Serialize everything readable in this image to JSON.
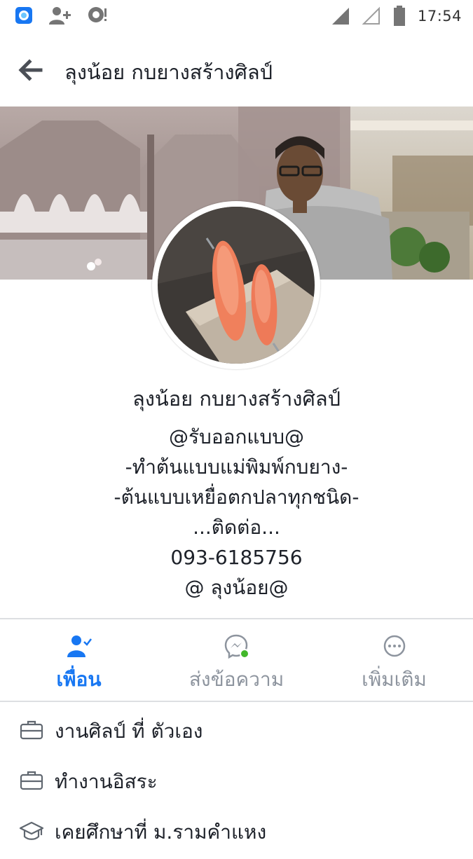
{
  "status_bar": {
    "time": "17:54",
    "icons": [
      "app-notification-icon",
      "friend-request-icon",
      "messenger-bubble-icon",
      "signal-full-icon",
      "signal-empty-icon",
      "battery-icon"
    ]
  },
  "app_bar": {
    "back_icon": "arrow-left-icon",
    "title": "ลุงน้อย กบยางสร้างศิลป์"
  },
  "profile": {
    "name": "ลุงน้อย กบยางสร้างศิลป์",
    "bio_lines": [
      "@รับออกแบบ@",
      "-ทำต้นแบบแม่พิมพ์กบยาง-",
      "-ต้นแบบเหยื่อตกปลาทุกชนิด-",
      "...ติดต่อ...",
      "093-6185756",
      "@ ลุงน้อย@"
    ]
  },
  "actions": [
    {
      "label": "เพื่อน",
      "icon": "friends-check-icon",
      "active": true
    },
    {
      "label": "ส่งข้อความ",
      "icon": "messenger-icon",
      "active": false
    },
    {
      "label": "เพิ่มเติม",
      "icon": "more-icon",
      "active": false
    }
  ],
  "info": [
    {
      "icon": "briefcase-icon",
      "text": "งานศิลป์ ที่ ตัวเอง"
    },
    {
      "icon": "briefcase-icon",
      "text": "ทำงานอิสระ"
    },
    {
      "icon": "graduation-cap-icon",
      "text": "เคยศึกษาที่ ม.รามคำแหง"
    }
  ],
  "colors": {
    "accent": "#1877f2",
    "muted": "#8d949e",
    "online": "#42b72a",
    "divider": "#dddfe2",
    "text": "#1d2129"
  }
}
